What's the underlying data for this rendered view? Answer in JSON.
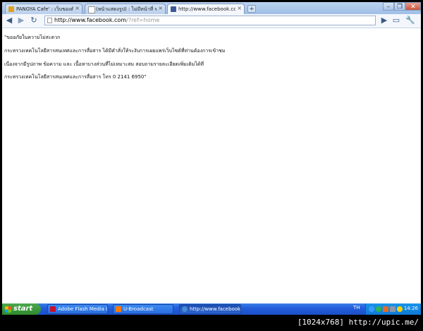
{
  "browser": {
    "tabs": [
      {
        "label": "PANGYA Cafe' : เว็บของด้าน...",
        "color": "#e0a020",
        "active": false
      },
      {
        "label": "(หน้าแสดงรูป) : ไม่มีหน้าที่ ฟ...",
        "color": "#ffffff",
        "active": false
      },
      {
        "label": "http://www.facebook.com/...",
        "color": "#3b5998",
        "active": true
      }
    ],
    "new_tab": "+",
    "window_controls": {
      "minimize": "–",
      "restore": "❐",
      "close": "✕"
    },
    "url_main": "http://www.facebook.com",
    "url_rest": "/?ref=home",
    "icons": [
      "back-icon",
      "forward-icon",
      "reload-icon",
      "star-icon",
      "play-icon",
      "page-menu-icon",
      "wrench-icon"
    ]
  },
  "content": {
    "lines": [
      "\"ขออภัยในความไม่สะดวก",
      "กระทรวงเทคโนโลยีสารสนเทศและการสื่อสาร ได้มีคำสั่งให้ระงับการเผยแพร่เว็บไซต์ที่ท่านต้องการเข้าชม",
      "เนื่องจากมีรูปภาพ ข้อความ และ เนื้อหาบางส่วนที่ไม่เหมาะสม สอบถามรายละเอียดเพิ่มเติมได้ที่",
      "กระทรวงเทคโนโลยีสารสนเทศและการสื่อสาร โทร 0 2141 6950\""
    ]
  },
  "taskbar": {
    "start_label": "start",
    "tasks": [
      {
        "label": "Adobe Flash Media Li...",
        "color": "#c8102e",
        "active": false
      },
      {
        "label": "U-Broadcast",
        "color": "#ff7a00",
        "active": false
      },
      {
        "label": "http://www.facebook...",
        "color": "#4a8ad4",
        "active": true
      }
    ],
    "tray_lang": "TH",
    "clock": "14:26"
  },
  "watermark": "[1024x768] http://upic.me/"
}
